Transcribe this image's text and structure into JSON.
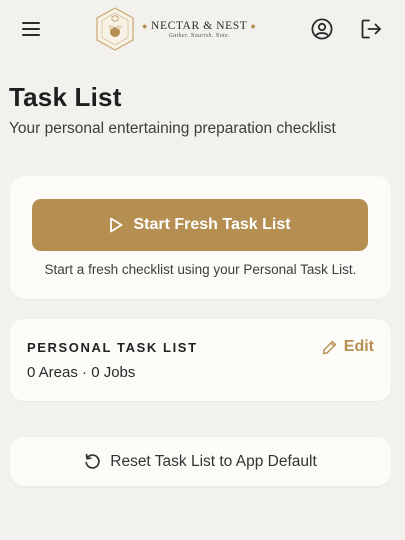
{
  "brand": {
    "name": "NECTAR & NEST",
    "tagline": "Gather. Nourish. Note.",
    "accent": "#b58f52"
  },
  "header": {
    "menu_icon": "hamburger-menu-icon",
    "profile_icon": "user-circle-icon",
    "logout_icon": "logout-icon"
  },
  "page": {
    "title": "Task List",
    "subtitle": "Your personal entertaining preparation checklist"
  },
  "start_card": {
    "button_label": "Start Fresh Task List",
    "button_icon": "play-icon",
    "description": "Start a fresh checklist using your Personal Task List."
  },
  "personal_list": {
    "title": "PERSONAL TASK LIST",
    "meta": "0 Areas · 0 Jobs",
    "edit_label": "Edit",
    "edit_icon": "pencil-icon"
  },
  "reset": {
    "label": "Reset Task List to App Default",
    "icon": "reset-icon"
  }
}
